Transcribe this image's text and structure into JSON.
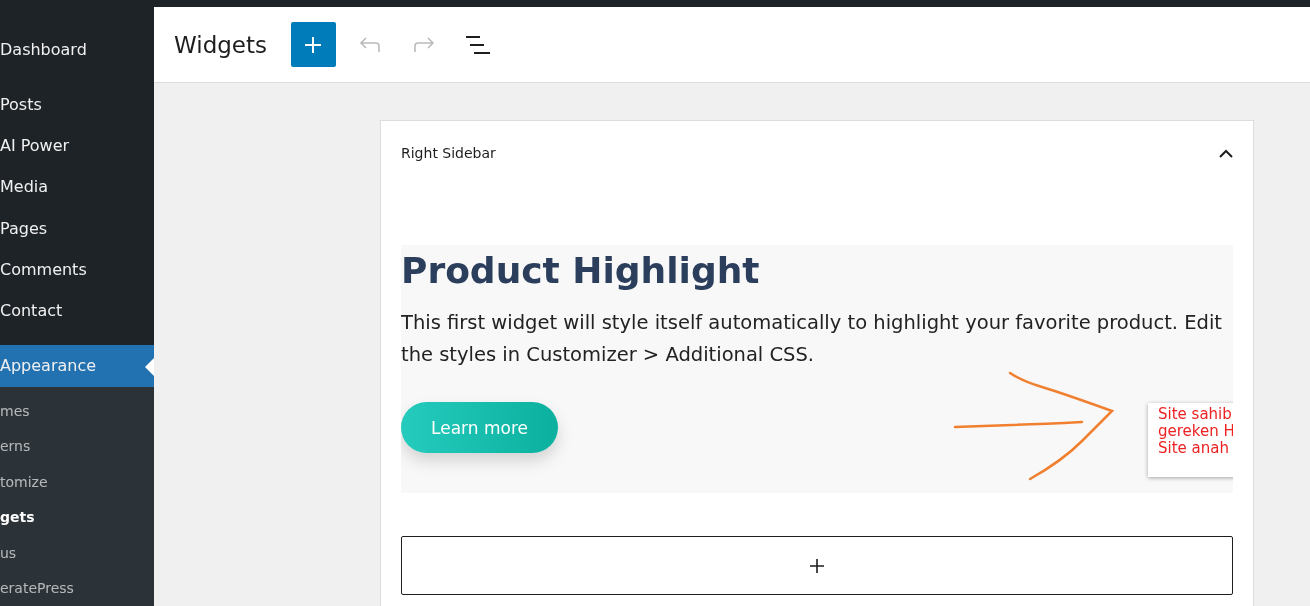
{
  "sidebar": {
    "items": [
      {
        "label": "Dashboard",
        "selected": false
      },
      {
        "label": "Posts",
        "selected": false
      },
      {
        "label": "AI Power",
        "selected": false
      },
      {
        "label": "Media",
        "selected": false
      },
      {
        "label": "Pages",
        "selected": false
      },
      {
        "label": "Comments",
        "selected": false
      },
      {
        "label": "Contact",
        "selected": false
      },
      {
        "label": "Appearance",
        "selected": true
      }
    ],
    "submenu": [
      {
        "label": "mes",
        "selected": false
      },
      {
        "label": "erns",
        "selected": false
      },
      {
        "label": "tomize",
        "selected": false
      },
      {
        "label": "gets",
        "selected": true
      },
      {
        "label": "us",
        "selected": false
      },
      {
        "label": "eratePress",
        "selected": false
      }
    ]
  },
  "header": {
    "title": "Widgets",
    "undo": {
      "disabled": true
    },
    "redo": {
      "disabled": true
    }
  },
  "area": {
    "title": "Right Sidebar",
    "expanded": true,
    "widget": {
      "heading": "Product Highlight",
      "text": "This first widget will style itself automatically to highlight your favorite product. Edit the styles in Customizer > Additional CSS.",
      "button": "Learn more",
      "note": [
        "Site sahib",
        "gereken H",
        "Site anah"
      ]
    }
  }
}
